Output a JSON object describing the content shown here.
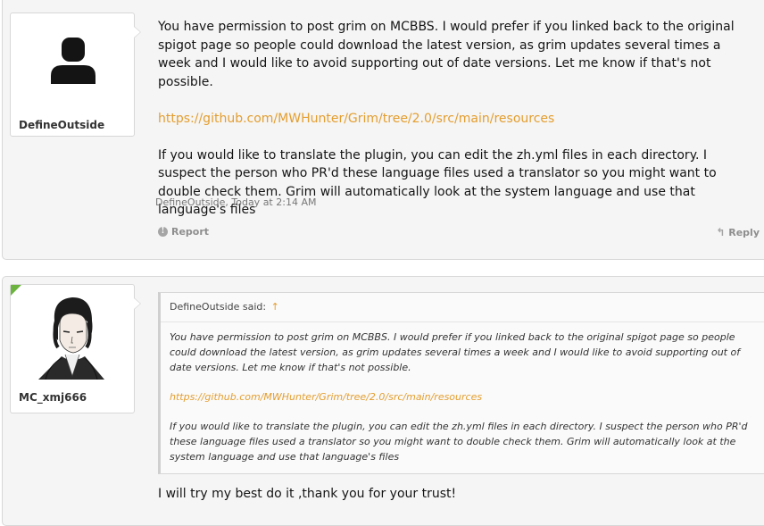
{
  "posts": [
    {
      "username": "DefineOutside",
      "avatar_icon": "default-user-silhouette-icon",
      "message": [
        "You have permission to post grim on MCBBS. I would prefer if you linked back to the original spigot page so people could download the latest version, as grim updates several times a week and I would like to avoid supporting out of date versions. Let me know if that's not possible.",
        "https://github.com/MWHunter/Grim/tree/2.0/src/main/resources",
        "If you would like to translate the plugin, you can edit the zh.yml files in each directory. I suspect the person who PR'd these language files used a translator so you might want to double check them. Grim will automatically look at the system language and use that language's files"
      ],
      "author_link": "DefineOutside",
      "timestamp": ", Today at 2:14 AM",
      "report_label": "Report",
      "reply_label": "Reply"
    },
    {
      "username": "MC_xmj666",
      "avatar_icon": "anime-character-avatar",
      "online_color": "#6cb33f",
      "quote": {
        "author": "DefineOutside said:",
        "arrow": "↑",
        "lines": [
          "You have permission to post grim on MCBBS. I would prefer if you linked back to the original spigot page so people could download the latest version, as grim updates several times a week and I would like to avoid supporting out of date versions. Let me know if that's not possible.",
          "https://github.com/MWHunter/Grim/tree/2.0/src/main/resources",
          "If you would like to translate the plugin, you can edit the zh.yml files in each directory. I suspect the person who PR'd these language files used a translator so you might want to double check them. Grim will automatically look at the system language and use that language's files"
        ]
      },
      "message": "I will try my best do it ,thank you for your trust!"
    }
  ],
  "colors": {
    "link": "#e49e2f",
    "post_background": "#f5f5f5",
    "border": "#d7d7d7"
  }
}
